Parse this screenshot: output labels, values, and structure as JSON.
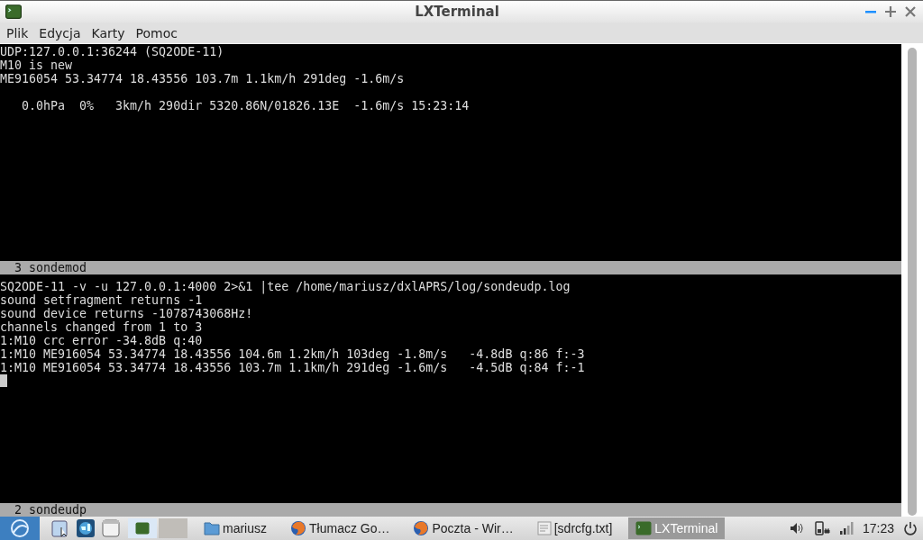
{
  "window": {
    "title": "LXTerminal"
  },
  "menu": [
    "Plik",
    "Edycja",
    "Karty",
    "Pomoc"
  ],
  "panes": [
    {
      "blocks": [
        [
          "UDP:127.0.0.1:36244 (SQ2ODE-11)",
          "M10 is new",
          "ME916054 53.34774 18.43556 103.7m 1.1km/h 291deg -1.6m/s"
        ],
        [
          "   0.0hPa  0%   3km/h 290dir 5320.86N/01826.13E  -1.6m/s 15:23:14"
        ]
      ],
      "status": "  3 sondemod",
      "cursor": false
    },
    {
      "blocks": [
        [
          "SQ2ODE-11 -v -u 127.0.0.1:4000 2>&1 |tee /home/mariusz/dxlAPRS/log/sondeudp.log",
          "sound setfragment returns -1",
          "sound device returns -1078743068Hz!",
          "channels changed from 1 to 3",
          "1:M10 crc error -34.8dB q:40",
          "1:M10 ME916054 53.34774 18.43556 104.6m 1.2km/h 103deg -1.8m/s   -4.8dB q:86 f:-3",
          "1:M10 ME916054 53.34774 18.43556 103.7m 1.1km/h 291deg -1.6m/s   -4.5dB q:84 f:-1"
        ]
      ],
      "status": "  2 sondeudp",
      "cursor": true
    }
  ],
  "taskbar": {
    "workspaces": [
      {
        "selected": true
      },
      {
        "selected": false
      }
    ],
    "tasks": [
      {
        "label": "mariusz",
        "kind": "folder",
        "selected": false
      },
      {
        "label": "Tłumacz Go…",
        "kind": "browser",
        "selected": false
      },
      {
        "label": "Poczta - Wir…",
        "kind": "browser",
        "selected": false
      },
      {
        "label": "[sdrcfg.txt]",
        "kind": "text",
        "selected": false
      },
      {
        "label": "LXTerminal",
        "kind": "terminal",
        "selected": true
      }
    ],
    "clock": "17:23"
  }
}
